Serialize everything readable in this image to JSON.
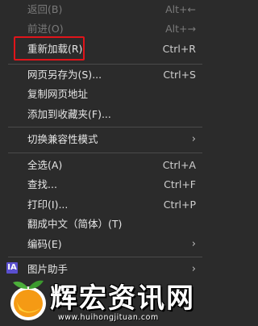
{
  "menu": {
    "items": [
      {
        "label": "返回(B)",
        "shortcut": "Alt+←"
      },
      {
        "label": "前进(O)",
        "shortcut": "Alt+→"
      },
      {
        "label": "重新加载(R)",
        "shortcut": "Ctrl+R"
      },
      {
        "label": "网页另存为(S)...",
        "shortcut": "Ctrl+S"
      },
      {
        "label": "复制网页地址",
        "shortcut": ""
      },
      {
        "label": "添加到收藏夹(F)...",
        "shortcut": ""
      },
      {
        "label": "切换兼容性模式",
        "shortcut": "",
        "submenu_arrow": "›"
      },
      {
        "label": "全选(A)",
        "shortcut": "Ctrl+A"
      },
      {
        "label": "查找...",
        "shortcut": "Ctrl+F"
      },
      {
        "label": "打印(I)...",
        "shortcut": "Ctrl+P"
      },
      {
        "label": "翻成中文（简体）(T)",
        "shortcut": ""
      },
      {
        "label": "编码(E)",
        "shortcut": "",
        "submenu_arrow": "›"
      },
      {
        "label": "图片助手",
        "shortcut": "",
        "submenu_arrow": "›",
        "icon": "IA"
      }
    ]
  },
  "watermark": {
    "text": "辉宏资讯网",
    "url": "www.huihongjituan.com"
  }
}
